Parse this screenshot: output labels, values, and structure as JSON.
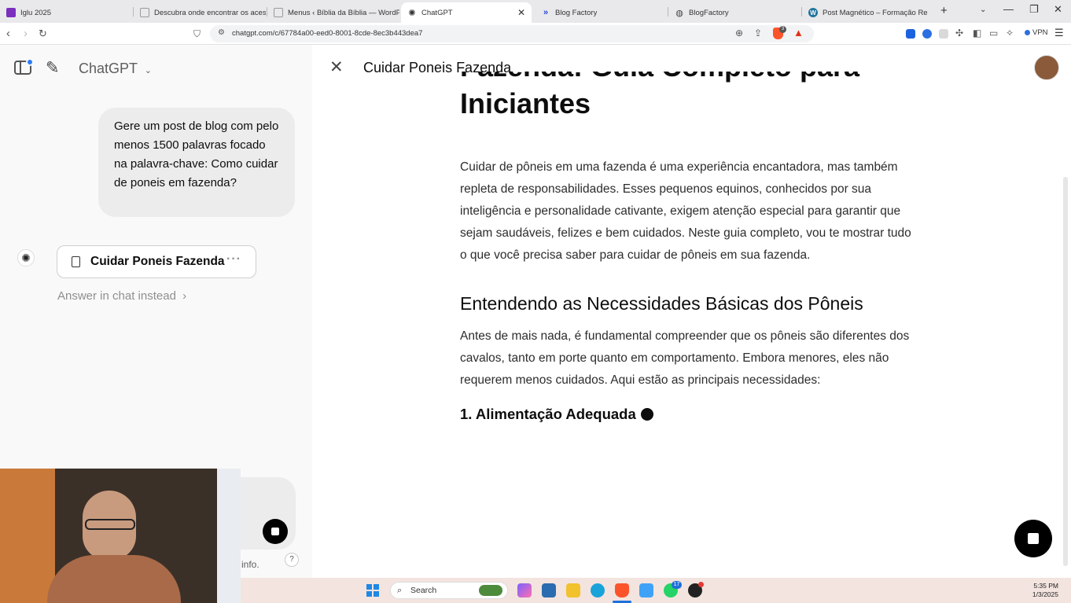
{
  "browser": {
    "tabs": [
      {
        "title": "Iglu 2025",
        "favicon": "purple-app-icon",
        "color": "#7b2fbe"
      },
      {
        "title": "Descubra onde encontrar os acessórios",
        "favicon": "page-icon",
        "color": "#9a9a9a"
      },
      {
        "title": "Menus ‹ Bíblia da Bíblia — WordPress",
        "favicon": "page-icon",
        "color": "#9a9a9a"
      },
      {
        "title": "ChatGPT",
        "favicon": "chatgpt-icon",
        "color": "#333333"
      },
      {
        "title": "Blog Factory",
        "favicon": "blog-factory-icon",
        "color": "#2845d8"
      },
      {
        "title": "BlogFactory",
        "favicon": "globe-icon",
        "color": "#444444"
      },
      {
        "title": "Post Magnético – Formação Renda",
        "favicon": "wordpress-icon",
        "color": "#21759b"
      }
    ],
    "new_tab": "+",
    "url": "chatgpt.com/c/67784a00-eed0-8001-8cde-8ec3b443dea7",
    "vpn_label": "VPN",
    "brave_badge": "3"
  },
  "chat": {
    "app_title": "ChatGPT",
    "user_message": "Gere um post de blog com pelo menos 1500 palavras focado na palavra-chave: Como cuidar de poneis em fazenda?",
    "doc_card_title": "Cuidar Poneis Fazenda",
    "doc_card_dots": "···",
    "answer_in_chat": "Answer in chat instead",
    "answer_chevron": "›",
    "footer_info": "info.",
    "help": "?"
  },
  "canvas": {
    "title": "Cuidar Poneis Fazenda",
    "close": "✕",
    "h1": "Fazenda: Guia Completo para Iniciantes",
    "intro": "Cuidar de pôneis em uma fazenda é uma experiência encantadora, mas também repleta de responsabilidades. Esses pequenos equinos, conhecidos por sua inteligência e personalidade cativante, exigem atenção especial para garantir que sejam saudáveis, felizes e bem cuidados. Neste guia completo, vou te mostrar tudo o que você precisa saber para cuidar de pôneis em sua fazenda.",
    "h2": "Entendendo as Necessidades Básicas dos Pôneis",
    "para2": "Antes de mais nada, é fundamental compreender que os pôneis são diferentes dos cavalos, tanto em porte quanto em comportamento. Embora menores, eles não requerem menos cuidados. Aqui estão as principais necessidades:",
    "h3": "1. Alimentação Adequada"
  },
  "taskbar": {
    "search_placeholder": "Search",
    "time": "5:35 PM",
    "date": "1/3/2025",
    "whatsapp_badge": "17"
  }
}
